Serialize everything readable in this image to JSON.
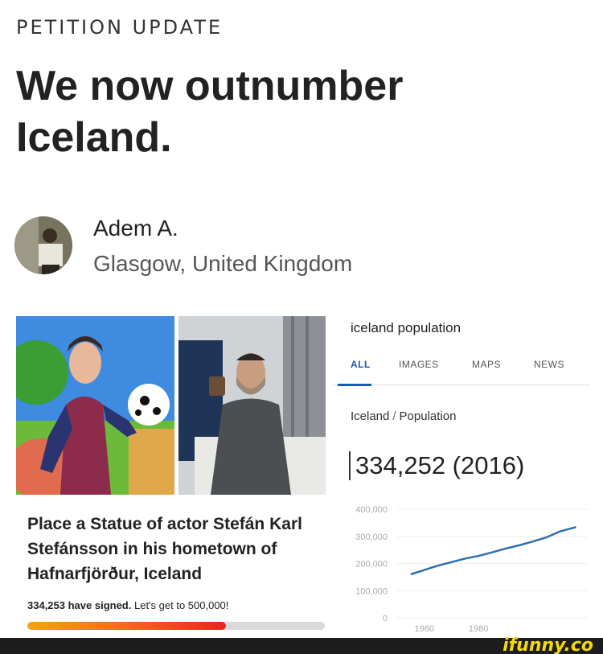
{
  "top_label": "PETITION UPDATE",
  "headline": "We now outnumber Iceland.",
  "author": {
    "name": "Adem A.",
    "location": "Glasgow, United Kingdom"
  },
  "petition": {
    "title": "Place a Statue of actor Stefán Karl Stefánsson in his hometown of Hafnarfjörður, Iceland",
    "signed": "334,253 have signed.",
    "goal_text": "Let's get to 500,000!",
    "progress": 0.668
  },
  "search": {
    "query": "iceland population",
    "tabs": [
      "ALL",
      "IMAGES",
      "MAPS",
      "NEWS"
    ],
    "active_tab": "ALL",
    "breadcrumb_country": "Iceland",
    "breadcrumb_sep": "/",
    "breadcrumb_topic": "Population",
    "big_value": "334,252 (2016)"
  },
  "chart_data": {
    "type": "line",
    "y_ticks": [
      "400,000",
      "300,000",
      "200,000",
      "100,000",
      "0"
    ],
    "x_ticks": [
      "1960",
      "1980"
    ],
    "ylim": [
      0,
      400000
    ],
    "xlim": [
      1950,
      2020
    ],
    "grid": true,
    "series": [
      {
        "x": [
          1955,
          1960,
          1965,
          1970,
          1975,
          1980,
          1985,
          1990,
          1995,
          2000,
          2005,
          2010,
          2016
        ],
        "values": [
          160000,
          176000,
          192000,
          205000,
          218000,
          228000,
          241000,
          255000,
          267000,
          281000,
          296000,
          318000,
          334252
        ]
      }
    ],
    "colors": {
      "line": "#2f6fad"
    }
  },
  "footer": {
    "logo": "ifunny.co"
  }
}
